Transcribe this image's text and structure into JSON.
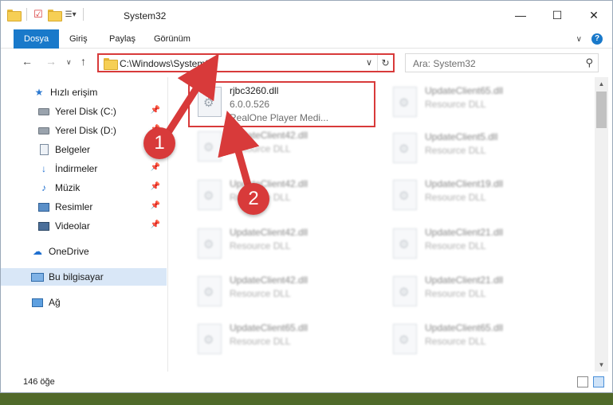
{
  "window": {
    "title": "System32"
  },
  "ribbon": {
    "tabs": [
      "Dosya",
      "Giriş",
      "Paylaş",
      "Görünüm"
    ]
  },
  "navbar": {
    "address": "C:\\Windows\\System32",
    "search_placeholder": "Ara: System32"
  },
  "sidebar": {
    "items": [
      {
        "label": "Hızlı erişim",
        "icon": "star-icon"
      },
      {
        "label": "Yerel Disk (C:)",
        "icon": "drive-icon",
        "pinned": true
      },
      {
        "label": "Yerel Disk (D:)",
        "icon": "drive-icon",
        "pinned": true
      },
      {
        "label": "Belgeler",
        "icon": "documents-icon",
        "pinned": true
      },
      {
        "label": "İndirmeler",
        "icon": "download-icon",
        "pinned": true
      },
      {
        "label": "Müzik",
        "icon": "music-icon",
        "pinned": true
      },
      {
        "label": "Resimler",
        "icon": "pictures-icon",
        "pinned": true
      },
      {
        "label": "Videolar",
        "icon": "videos-icon",
        "pinned": true
      },
      {
        "label": "OneDrive",
        "icon": "cloud-icon"
      },
      {
        "label": "Bu bilgisayar",
        "icon": "computer-icon",
        "selected": true
      },
      {
        "label": "Ağ",
        "icon": "network-icon"
      }
    ]
  },
  "files": {
    "main": {
      "name": "rjbc3260.dll",
      "version": "6.0.0.526",
      "description": "RealOne Player Medi..."
    },
    "left_column": [
      {
        "name": "UpdateClient42.dll",
        "type": "Resource DLL"
      },
      {
        "name": "UpdateClient42.dll",
        "type": "Resource DLL"
      },
      {
        "name": "UpdateClient42.dll",
        "type": "Resource DLL"
      },
      {
        "name": "UpdateClient42.dll",
        "type": "Resource DLL"
      },
      {
        "name": "UpdateClient65.dll",
        "type": "Resource DLL"
      }
    ],
    "right_column": [
      {
        "name": "UpdateClient65.dll",
        "type": "Resource DLL"
      },
      {
        "name": "UpdateClient5.dll",
        "type": "Resource DLL"
      },
      {
        "name": "UpdateClient19.dll",
        "type": "Resource DLL"
      },
      {
        "name": "UpdateClient21.dll",
        "type": "Resource DLL"
      },
      {
        "name": "UpdateClient21.dll",
        "type": "Resource DLL"
      },
      {
        "name": "UpdateClient65.dll",
        "type": "Resource DLL"
      }
    ]
  },
  "status": {
    "item_count": "146 öğe"
  },
  "annotations": {
    "step1": "1",
    "step2": "2"
  },
  "colors": {
    "accent": "#1979ca",
    "highlight": "#d83a3a"
  }
}
